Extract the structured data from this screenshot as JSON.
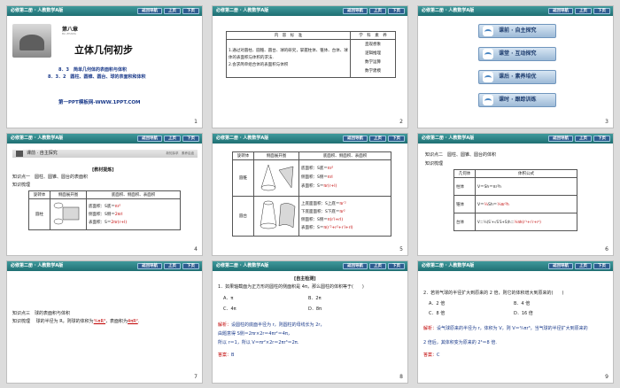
{
  "header": {
    "title": "必修第二册 · 人教数学A版",
    "btn_nav": "返回导航",
    "btn_prev": "上页",
    "btn_next": "下页"
  },
  "slide1": {
    "chapter": "第八章",
    "chapter_sub": "BA ZHANG",
    "title": "立体几何初步",
    "sec1": "8．3　简单几何体的表面积与体积",
    "sec2": "8．3．2　圆柱、圆锥、圆台、球的表面积和体积",
    "footer": "第一PPT模板网-WWW.1PPT.COM",
    "num": "1"
  },
  "slide2": {
    "col1": "内　容　标　准",
    "col2": "学　科　素　养",
    "std1": "1.通过对圆柱、圆锥、圆台、球的研究，掌握柱体、锥体、台体、球体的表面积与体积的求法.",
    "std2": "2.会求简单组合体的表面积与体积",
    "skills": [
      "直观想象",
      "逻辑推理",
      "数学运算",
      "数学建模"
    ],
    "num": "2"
  },
  "slide3": {
    "items": [
      "课前 · 自主探究",
      "课堂 · 互动探究",
      "课后 · 素养培优",
      "课时 · 跟踪训练"
    ],
    "num": "3"
  },
  "slide4": {
    "bar": "课前 · 自主探究",
    "bar_right": "新知探求　素养启迪",
    "teach": "[教材提炼]",
    "point1": "知识点一　圆柱、圆锥、圆台的表面积",
    "comb": "知识梳理",
    "th": [
      "旋转体",
      "侧面展开图",
      "底面积、侧面积、表面积"
    ],
    "row": "圆柱",
    "f1": "底面积：S底＝",
    "f1a": "πr²",
    "f2": "侧面积：S侧＝",
    "f2a": "2πrl",
    "f3": "表面积：S＝",
    "f3a": "2πr(r+l)",
    "num": "4"
  },
  "slide5": {
    "th": [
      "旋转体",
      "侧面展开图",
      "底面积、侧面积、表面积"
    ],
    "row1": "圆锥",
    "r1f1": "底面积：S底＝",
    "r1a1": "πr²",
    "r1f2": "侧面积：S侧＝",
    "r1a2": "πrl",
    "r1f3": "表面积：S＝",
    "r1a3": "πr(r+l)",
    "row2": "圆台",
    "r2f1": "上底面面积：S上底＝",
    "r2a1": "πr′²",
    "r2f2": "下底面面积：S下底＝",
    "r2a2": "πr²",
    "r2f3": "侧面积：S侧＝",
    "r2a3": "π(r′l+rl)",
    "r2f4": "表面积：S＝",
    "r2a4": "π(r′²+r²+r′l+rl)",
    "num": "5"
  },
  "slide6": {
    "point2": "知识点二　圆柱、圆锥、圆台的体积",
    "comb": "知识梳理",
    "th": [
      "几何体",
      "体积公式"
    ],
    "rows": [
      "柱体",
      "锥体",
      "台体"
    ],
    "v1": "V＝Sh＝πr²h",
    "v2a": "V＝",
    "v2b": "Sh＝",
    "v2c": "πr²h",
    "v3a": "V＝",
    "v3b": "(S′+",
    "v3c": "+S)h＝",
    "v3d": "πh(r′²+r′r+r²)",
    "num": "6"
  },
  "slide7": {
    "point3": "知识点三　球的表面积与体积",
    "comb": "知识梳理",
    "t1": "球的半径为 R，则球的体积为",
    "a1": "⁴⁄₃πR³",
    "t2": "，表面积为",
    "a2": "4πR²",
    "t3": ".",
    "num": "7"
  },
  "slide8": {
    "head": "[自主检测]",
    "q": "1．如果轴截面为正方形的圆柱的侧面积是 4π，那么圆柱的体积等于(　　)",
    "opts": [
      "A．π",
      "B．2π",
      "C．4π",
      "D．8π"
    ],
    "sol_label": "解析：",
    "sol1": "设圆柱的底面半径为 r，则圆柱的母线长为 2r，",
    "sol2": "由题意得 S侧＝2πr×2r＝4πr²＝4π，",
    "sol3": "所以 r＝1，所以 V＝πr²×2r＝2πr³＝2π.",
    "ans_label": "答案：",
    "ans": "B",
    "num": "8"
  },
  "slide9": {
    "q": "2．若将气球的半径扩大到原来的 2 倍，则它的体积增大到原来的(　　)",
    "opts": [
      "A．2 倍",
      "B．4 倍",
      "C．8 倍",
      "D．16 倍"
    ],
    "sol_label": "解析：",
    "sol1": "设气球原来的半径为 r，体积为 V，则 V＝⁴⁄₃πr³，当气球的半径扩大到原来的",
    "sol2": "2 倍后，其体积变为原来的 2³＝8 倍.",
    "ans_label": "答案：",
    "ans": "C",
    "num": "9"
  }
}
